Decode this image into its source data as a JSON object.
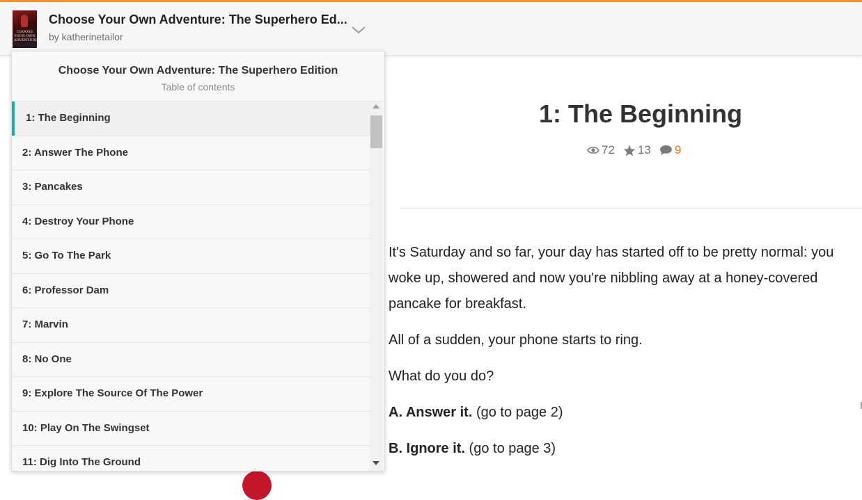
{
  "story": {
    "title": "Choose Your Own Adventure: The Superhero Ed...",
    "author": "by katherinetailor"
  },
  "toc": {
    "title": "Choose Your Own Adventure: The Superhero Edition",
    "subtitle": "Table of contents",
    "items": [
      {
        "label": "1: The Beginning",
        "active": true
      },
      {
        "label": "2: Answer The Phone"
      },
      {
        "label": "3: Pancakes"
      },
      {
        "label": "4: Destroy Your Phone"
      },
      {
        "label": "5: Go To The Park"
      },
      {
        "label": "6: Professor Dam"
      },
      {
        "label": "7: Marvin"
      },
      {
        "label": "8: No One"
      },
      {
        "label": "9: Explore The Source Of The Power"
      },
      {
        "label": "10: Play On The Swingset"
      },
      {
        "label": "11: Dig Into The Ground"
      }
    ]
  },
  "part": {
    "title": "1: The Beginning",
    "reads": "72",
    "votes": "13",
    "comments": "9"
  },
  "content": {
    "p1": "It's Saturday and so far, your day has started off to be pretty normal: you woke up, showered and now you're nibbling away at a honey-covered pancake for breakfast.",
    "p2": "All of a sudden, your phone starts to ring.",
    "p3": "What do you do?",
    "optA_bold": "A. Answer it.",
    "optA_rest": " (go to page 2)",
    "optB_bold": "B. Ignore it.",
    "optB_rest": " (go to page 3)"
  },
  "cover": {
    "text": "CHOOSE YOUR OWN ADVENTURE"
  },
  "colors": {
    "accent": "#ff8f26",
    "active_marker": "#19b1a6",
    "comment_count": "#e07a1f"
  },
  "icons": {
    "reads": "eye-icon",
    "votes": "star-icon",
    "comments": "comment-icon",
    "toggle": "chevron-down-icon"
  }
}
